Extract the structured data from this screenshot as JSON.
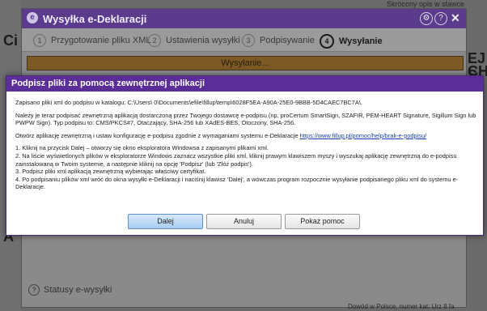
{
  "background": {
    "left_letter": "Ci",
    "left_letter_2": "A",
    "right_text_1": "EJ S",
    "right_text_2": "CH",
    "top_hint": "Skrócony opis w stawce",
    "bottom_right": "Dowód w Polsce, numer kat: Urz 8 fa"
  },
  "wizard": {
    "logo": "e",
    "title": "Wysyłka e-Deklaracji",
    "settings_icon": "gear-icon",
    "help_icon": "question-icon",
    "close_icon": "close-icon",
    "steps": [
      {
        "num": "1",
        "label": "Przygotowanie pliku XML"
      },
      {
        "num": "2",
        "label": "Ustawienia wysyłki"
      },
      {
        "num": "3",
        "label": "Podpisywanie"
      },
      {
        "num": "4",
        "label": "Wysyłanie"
      }
    ],
    "active_step": 4,
    "progress_label": "Wysyłanie...",
    "progress_fraction": 1.0,
    "status_link": "Statusy e-wysyłki"
  },
  "modal": {
    "title": "Podpisz pliki za pomocą zewnętrznej aplikacji",
    "p1": "Zapisano pliki xml do podpisu w katalogu: C:\\Users\\        0\\Documents\\efile\\fillup\\temp\\6028F5EA-A90A-25E0-9BBB-5D4CAEC7BC7A\\.",
    "p2": "Należy je teraz podpisać zewnętrzną aplikacją dostarczoną przez Twojego dostawcę e-podpisu (np. proCertum SmartSign, SZAFIR, PEM-HEART Signature, Sigillum Sign lub PWPW Sign). Typ podpisu to: CMS/PKCS#7, Otaczający, SHA-256 lub XAdES-BES, Otoczony, SHA-256.",
    "p3_prefix": "Otwórz aplikację zewnętrzną i ustaw konfigurację e-podpisu zgodnie z wymaganiami systemu e-Deklaracje ",
    "p3_link": "https://www.fillup.pl/pomoc/help/brak-e-podpisu/",
    "steps": [
      "1. Kliknij na przycisk Dalej – otworzy się okno eksploratora Windowsa z zapisanymi plikami xml.",
      "2. Na liście wyświetlonych plików w eksploratorze Windows zaznacz wszystkie pliki xml, kliknij prawym klawiszem myszy i wyszukaj aplikację zewnętrzną do e-podpisu zainstalowaną w Twoim systemie, a następnie kliknij na opcję 'Podpisz' (lub 'Złóż podpis').",
      "3. Podpisz pliki xml aplikacją zewnętrzną wybierając właściwy certyfikat.",
      "4. Po podpisaniu plików xml wróć do okna wysyłki e-Deklaracji i naciśnij klawisz 'Dalej', a wówczas program rozpocznie wysyłanie podpisanego pliku xml do systemu e-Deklaracje."
    ],
    "buttons": {
      "next": "Dalej",
      "cancel": "Anuluj",
      "help": "Pokaż pomoc"
    }
  },
  "colors": {
    "titlebar": "#5a3b8c",
    "modal_header": "#5b2d98",
    "primary_button": "#a9cdf2"
  }
}
